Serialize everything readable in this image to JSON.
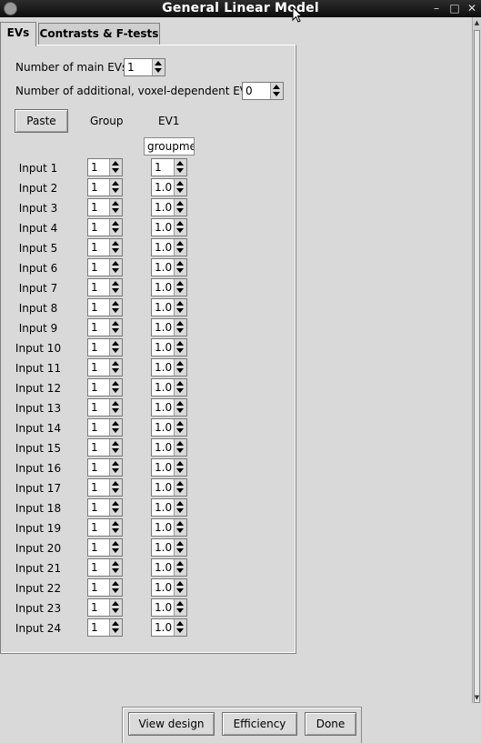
{
  "window": {
    "title": "General Linear Model",
    "controls": [
      "–",
      "□",
      "✕"
    ]
  },
  "tabs": [
    {
      "label": "EVs",
      "active": true
    },
    {
      "label": "Contrasts & F-tests",
      "active": false
    }
  ],
  "evs": {
    "main_evs_label": "Number of main EVs",
    "main_evs_value": "1",
    "additional_evs_label": "Number of additional, voxel-dependent EVs",
    "additional_evs_value": "0",
    "paste_label": "Paste",
    "group_header": "Group",
    "ev1_header": "EV1",
    "ev1_name": "groupmean"
  },
  "inputs": [
    {
      "label": "Input 1",
      "group": "1",
      "ev1": "1"
    },
    {
      "label": "Input 2",
      "group": "1",
      "ev1": "1.0"
    },
    {
      "label": "Input 3",
      "group": "1",
      "ev1": "1.0"
    },
    {
      "label": "Input 4",
      "group": "1",
      "ev1": "1.0"
    },
    {
      "label": "Input 5",
      "group": "1",
      "ev1": "1.0"
    },
    {
      "label": "Input 6",
      "group": "1",
      "ev1": "1.0"
    },
    {
      "label": "Input 7",
      "group": "1",
      "ev1": "1.0"
    },
    {
      "label": "Input 8",
      "group": "1",
      "ev1": "1.0"
    },
    {
      "label": "Input 9",
      "group": "1",
      "ev1": "1.0"
    },
    {
      "label": "Input 10",
      "group": "1",
      "ev1": "1.0"
    },
    {
      "label": "Input 11",
      "group": "1",
      "ev1": "1.0"
    },
    {
      "label": "Input 12",
      "group": "1",
      "ev1": "1.0"
    },
    {
      "label": "Input 13",
      "group": "1",
      "ev1": "1.0"
    },
    {
      "label": "Input 14",
      "group": "1",
      "ev1": "1.0"
    },
    {
      "label": "Input 15",
      "group": "1",
      "ev1": "1.0"
    },
    {
      "label": "Input 16",
      "group": "1",
      "ev1": "1.0"
    },
    {
      "label": "Input 17",
      "group": "1",
      "ev1": "1.0"
    },
    {
      "label": "Input 18",
      "group": "1",
      "ev1": "1.0"
    },
    {
      "label": "Input 19",
      "group": "1",
      "ev1": "1.0"
    },
    {
      "label": "Input 20",
      "group": "1",
      "ev1": "1.0"
    },
    {
      "label": "Input 21",
      "group": "1",
      "ev1": "1.0"
    },
    {
      "label": "Input 22",
      "group": "1",
      "ev1": "1.0"
    },
    {
      "label": "Input 23",
      "group": "1",
      "ev1": "1.0"
    },
    {
      "label": "Input 24",
      "group": "1",
      "ev1": "1.0"
    }
  ],
  "footer": {
    "view_design": "View design",
    "efficiency": "Efficiency",
    "done": "Done"
  }
}
